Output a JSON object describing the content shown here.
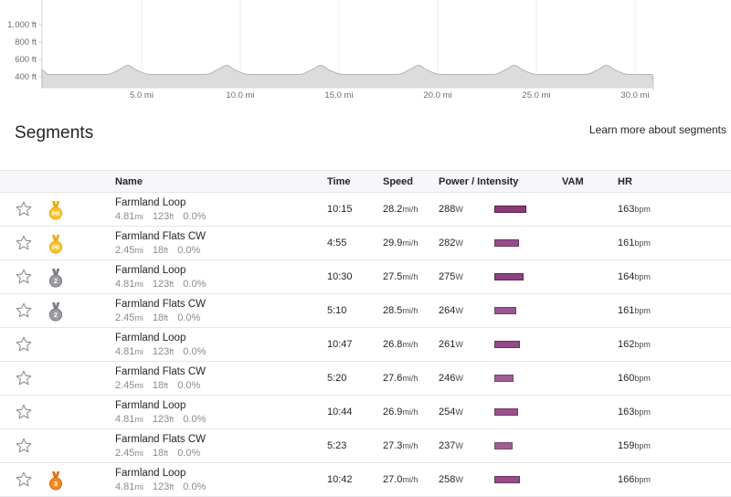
{
  "elevation": {
    "y_ticks": [
      "1,000 ft",
      "800 ft",
      "600 ft",
      "400 ft"
    ],
    "x_ticks": [
      "5.0 mi",
      "10.0 mi",
      "15.0 mi",
      "20.0 mi",
      "25.0 mi",
      "30.0 mi"
    ],
    "fill_color": "#dcdcdc",
    "stroke_color": "#b5b5b5"
  },
  "segments": {
    "title": "Segments",
    "learn_more": "Learn more about segments",
    "columns": {
      "name": "Name",
      "time": "Time",
      "speed": "Speed",
      "power": "Power / Intensity",
      "vam": "VAM",
      "hr": "HR"
    },
    "units": {
      "distance": "mi",
      "elevation": "ft",
      "speed": "mi/h",
      "power": "W",
      "hr": "bpm"
    },
    "intensity_color": "#8b3a7e",
    "rows": [
      {
        "name": "Farmland Loop",
        "distance": "4.81",
        "elev": "123",
        "grade": "0.0%",
        "time": "10:15",
        "speed": "28.2",
        "power": "288",
        "hr": "163",
        "medal": "pr",
        "medal_text": "PR",
        "intensity": 1.0
      },
      {
        "name": "Farmland Flats CW",
        "distance": "2.45",
        "elev": "18",
        "grade": "0.0%",
        "time": "4:55",
        "speed": "29.9",
        "power": "282",
        "hr": "161",
        "medal": "pr",
        "medal_text": "PR",
        "intensity": 0.78
      },
      {
        "name": "Farmland Loop",
        "distance": "4.81",
        "elev": "123",
        "grade": "0.0%",
        "time": "10:30",
        "speed": "27.5",
        "power": "275",
        "hr": "164",
        "medal": "silver",
        "medal_text": "2",
        "intensity": 0.91
      },
      {
        "name": "Farmland Flats CW",
        "distance": "2.45",
        "elev": "18",
        "grade": "0.0%",
        "time": "5:10",
        "speed": "28.5",
        "power": "264",
        "hr": "161",
        "medal": "silver",
        "medal_text": "2",
        "intensity": 0.69
      },
      {
        "name": "Farmland Loop",
        "distance": "4.81",
        "elev": "123",
        "grade": "0.0%",
        "time": "10:47",
        "speed": "26.8",
        "power": "261",
        "hr": "162",
        "medal": "",
        "medal_text": "",
        "intensity": 0.8
      },
      {
        "name": "Farmland Flats CW",
        "distance": "2.45",
        "elev": "18",
        "grade": "0.0%",
        "time": "5:20",
        "speed": "27.6",
        "power": "246",
        "hr": "160",
        "medal": "",
        "medal_text": "",
        "intensity": 0.6
      },
      {
        "name": "Farmland Loop",
        "distance": "4.81",
        "elev": "123",
        "grade": "0.0%",
        "time": "10:44",
        "speed": "26.9",
        "power": "254",
        "hr": "163",
        "medal": "",
        "medal_text": "",
        "intensity": 0.74
      },
      {
        "name": "Farmland Flats CW",
        "distance": "2.45",
        "elev": "18",
        "grade": "0.0%",
        "time": "5:23",
        "speed": "27.3",
        "power": "237",
        "hr": "159",
        "medal": "",
        "medal_text": "",
        "intensity": 0.57
      },
      {
        "name": "Farmland Loop",
        "distance": "4.81",
        "elev": "123",
        "grade": "0.0%",
        "time": "10:42",
        "speed": "27.0",
        "power": "258",
        "hr": "166",
        "medal": "bronze",
        "medal_text": "3",
        "intensity": 0.8
      }
    ]
  }
}
